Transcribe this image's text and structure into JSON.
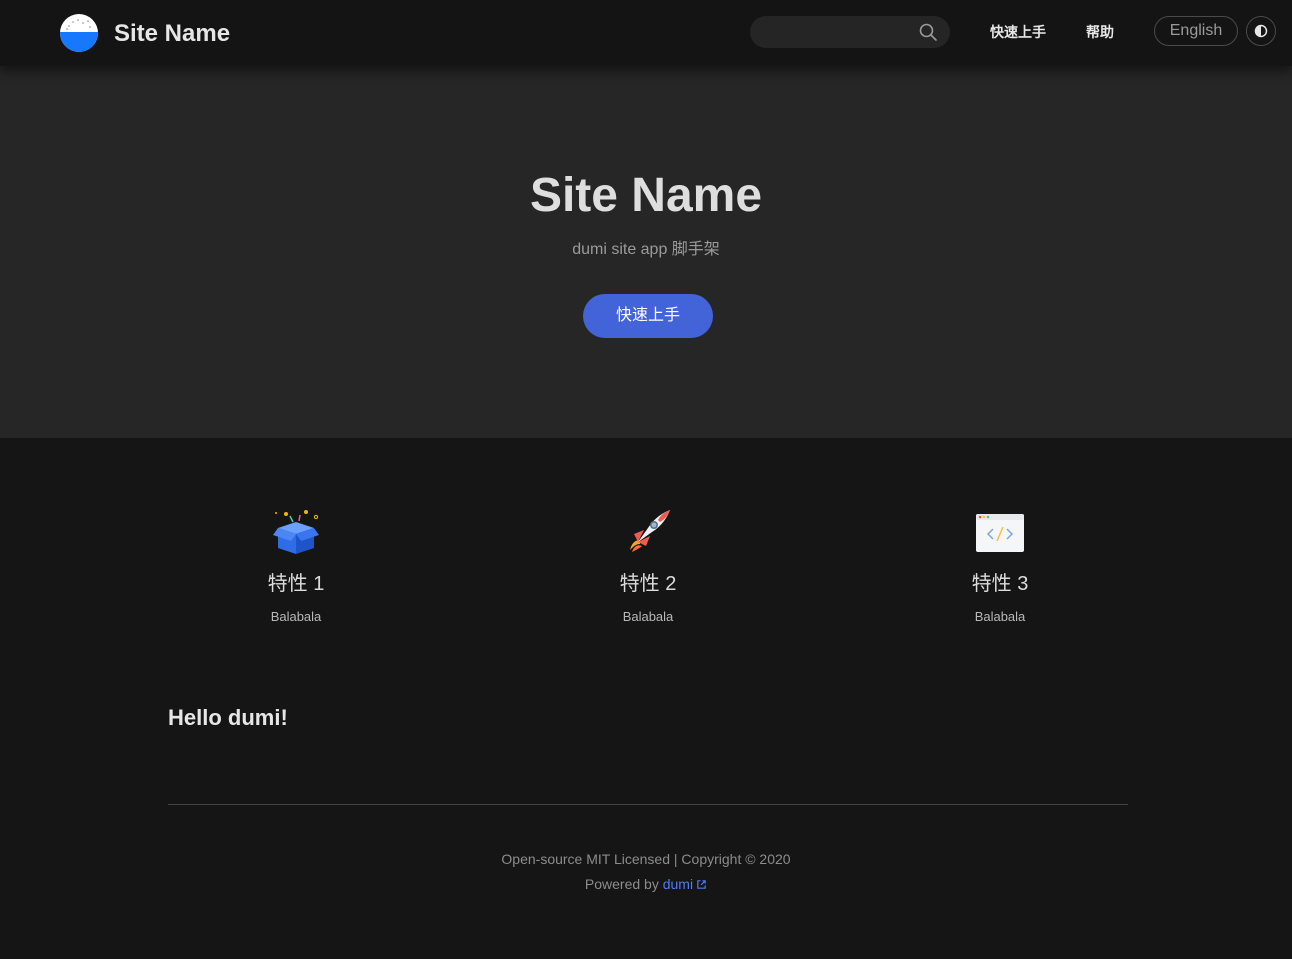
{
  "navbar": {
    "site_name": "Site Name",
    "logo_icon": "rice-bowl-logo-icon",
    "search": {
      "placeholder": "",
      "value": "",
      "icon": "search-icon"
    },
    "links": [
      {
        "label": "快速上手"
      },
      {
        "label": "帮助"
      }
    ],
    "language_button": "English",
    "theme_toggle_icon": "half-circle-contrast-icon"
  },
  "hero": {
    "title": "Site Name",
    "description": "dumi site app 脚手架",
    "cta_label": "快速上手",
    "cta_color": "#4363d8"
  },
  "features": [
    {
      "icon": "open-box-icon",
      "title": "特性 1",
      "description": "Balabala"
    },
    {
      "icon": "rocket-icon",
      "title": "特性 2",
      "description": "Balabala"
    },
    {
      "icon": "code-window-icon",
      "title": "特性 3",
      "description": "Balabala"
    }
  ],
  "content": {
    "heading": "Hello dumi!"
  },
  "footer": {
    "license_text": "Open-source MIT Licensed | Copyright © 2020",
    "powered_by_prefix": "Powered by",
    "powered_by_link": "dumi",
    "link_color": "#4c7cf3"
  },
  "colors": {
    "page_background": "#151515",
    "hero_background": "#262626",
    "navbar_background": "#141414"
  }
}
